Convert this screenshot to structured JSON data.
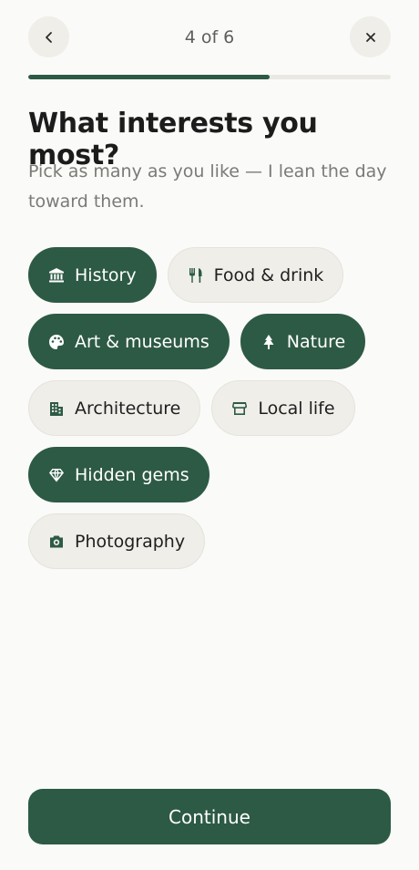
{
  "header": {
    "step_label": "4 of 6",
    "back_icon": "chevron-left-icon",
    "close_icon": "close-icon"
  },
  "progress": {
    "current": 4,
    "total": 6,
    "fraction": 0.667
  },
  "title": "What interests you most?",
  "subtitle": "Pick as many as you like — I lean the day toward them.",
  "interests": [
    {
      "label": "History",
      "icon": "museum-icon",
      "selected": true
    },
    {
      "label": "Food & drink",
      "icon": "utensils-icon",
      "selected": false
    },
    {
      "label": "Art & museums",
      "icon": "palette-icon",
      "selected": true
    },
    {
      "label": "Nature",
      "icon": "tree-icon",
      "selected": true
    },
    {
      "label": "Architecture",
      "icon": "building-icon",
      "selected": false
    },
    {
      "label": "Local life",
      "icon": "storefront-icon",
      "selected": false
    },
    {
      "label": "Hidden gems",
      "icon": "gem-icon",
      "selected": true
    },
    {
      "label": "Photography",
      "icon": "camera-icon",
      "selected": false
    }
  ],
  "continue_label": "Continue",
  "colors": {
    "accent": "#2d5a45",
    "chip_unselected": "#efeee9",
    "background": "#fafaf8"
  }
}
